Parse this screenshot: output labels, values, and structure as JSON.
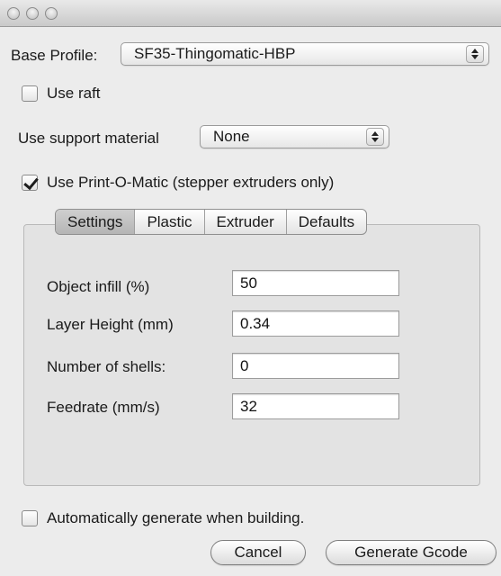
{
  "window": {
    "buttons": [
      "close",
      "minimize",
      "zoom"
    ]
  },
  "base_profile": {
    "label": "Base Profile:",
    "value": "SF35-Thingomatic-HBP"
  },
  "use_raft": {
    "label": "Use raft",
    "checked": false
  },
  "support_material": {
    "label": "Use support material",
    "value": "None"
  },
  "print_o_matic": {
    "label": "Use Print-O-Matic (stepper extruders only)",
    "checked": true
  },
  "tabs": [
    {
      "label": "Settings",
      "active": true
    },
    {
      "label": "Plastic",
      "active": false
    },
    {
      "label": "Extruder",
      "active": false
    },
    {
      "label": "Defaults",
      "active": false
    }
  ],
  "settings": {
    "fields": [
      {
        "label": "Object infill (%)",
        "value": "50"
      },
      {
        "label": "Layer Height (mm)",
        "value": "0.34"
      },
      {
        "label": "Number of shells:",
        "value": "0"
      },
      {
        "label": "Feedrate (mm/s)",
        "value": "32"
      }
    ]
  },
  "auto_generate": {
    "label": "Automatically generate when building.",
    "checked": false
  },
  "actions": {
    "cancel_label": "Cancel",
    "generate_label": "Generate Gcode"
  }
}
